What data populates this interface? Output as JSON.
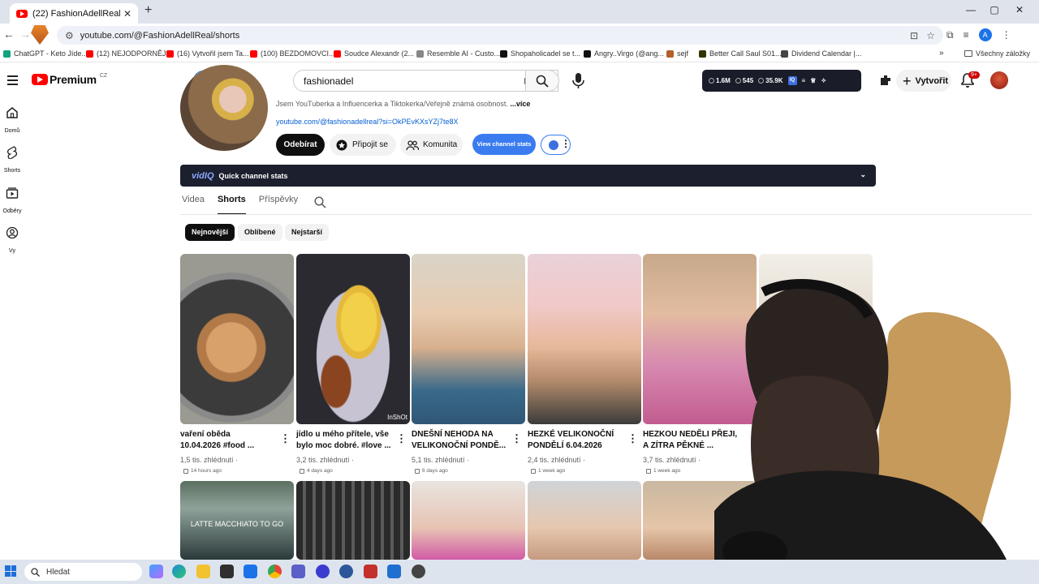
{
  "browser": {
    "tab_title": "(22) FashionAdellReal - YouTube",
    "url": "youtube.com/@FashionAdellReal/shorts",
    "bookmarks": [
      {
        "label": "ChatGPT - Keto Jíde...",
        "color": "#10a37f"
      },
      {
        "label": "(12) NEJODPORNĚJ...",
        "color": "#ff0000"
      },
      {
        "label": "(16) Vytvořil jsem Ta...",
        "color": "#ff0000"
      },
      {
        "label": "(100) BEZDOMOVCI...",
        "color": "#ff0000"
      },
      {
        "label": "Soudce Alexandr (2...",
        "color": "#ff0000"
      },
      {
        "label": "Resemble AI - Custo...",
        "color": "#888888"
      },
      {
        "label": "Shopaholicadel se t...",
        "color": "#111111"
      },
      {
        "label": "Angry..Virgo (@ang...",
        "color": "#111111"
      },
      {
        "label": "sejf",
        "color": "#b3602a"
      },
      {
        "label": "Better Call Saul S01...",
        "color": "#333300"
      },
      {
        "label": "Dividend Calendar |...",
        "color": "#444444"
      }
    ],
    "bookmarks_more": "»",
    "all_bookmarks": "Všechny záložky"
  },
  "youtube": {
    "logo_word": "Premium",
    "logo_region": "CZ",
    "search_value": "fashionadel",
    "stats": {
      "views": "1.6M",
      "videos": "545",
      "subs": "35.9K"
    },
    "create_label": "Vytvořit",
    "notif_count": "9+"
  },
  "guide": [
    {
      "label": "Domů",
      "icon": "home-icon"
    },
    {
      "label": "Shorts",
      "icon": "shorts-icon"
    },
    {
      "label": "Odběry",
      "icon": "subscriptions-icon"
    },
    {
      "label": "Vy",
      "icon": "you-icon"
    }
  ],
  "channel": {
    "description": "Jsem YouTuberka a Influencerka a Tiktokerka/Veřejně známá osobnost.",
    "more": "...více",
    "link": "youtube.com/@fashionadellreal?si=OkPEvKXsYZj7te8X",
    "subscribe": "Odebírat",
    "join": "Připojit se",
    "community": "Komunita",
    "view_stats": "View channel stats",
    "quick_stats_brand": "vidIQ",
    "quick_stats": "Quick channel stats"
  },
  "tabs": [
    "Videa",
    "Shorts",
    "Příspěvky"
  ],
  "filters": [
    "Nejnovější",
    "Oblíbené",
    "Nejstarší"
  ],
  "shorts": [
    {
      "title1": "vaření oběda",
      "title2": "10.04.2026 #food ...",
      "views": "1,5 tis. zhlédnutí ·",
      "age": "14 hours ago"
    },
    {
      "title1": "jídlo u mého přítele, vše",
      "title2": "bylo moc dobré. #love ...",
      "views": "3,2 tis. zhlédnutí ·",
      "age": "4 days ago"
    },
    {
      "title1": "DNEŠNÍ NEHODA NA",
      "title2": "VELIKONOČNÍ PONDĚ...",
      "views": "5,1 tis. zhlédnutí ·",
      "age": "6 days ago"
    },
    {
      "title1": "HEZKÉ VELIKONOČNÍ",
      "title2": "PONDĚLÍ 6.04.2026",
      "views": "2,4 tis. zhlédnutí ·",
      "age": "1 week ago"
    },
    {
      "title1": "HEZKOU NEDĚLI PŘEJI,",
      "title2": "A ZÍTRA PĚKNÉ ...",
      "views": "3,7 tis. zhlédnutí ·",
      "age": "1 week ago"
    }
  ],
  "row2_caption": "LATTE MACCHIATO TO GO",
  "thumb_watermark": "InShOt",
  "taskbar": {
    "search_placeholder": "Hledat"
  }
}
